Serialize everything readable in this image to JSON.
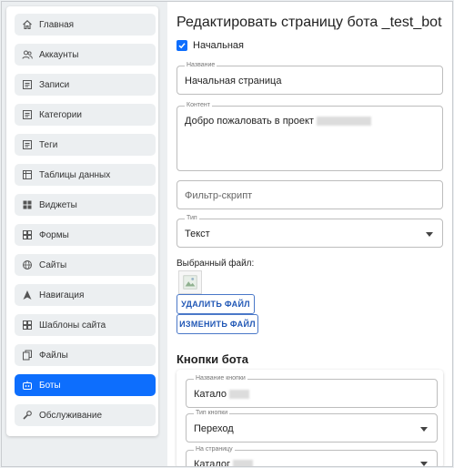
{
  "sidebar": {
    "items": [
      {
        "label": "Главная",
        "icon": "home-icon"
      },
      {
        "label": "Аккаунты",
        "icon": "users-icon"
      },
      {
        "label": "Записи",
        "icon": "document-icon"
      },
      {
        "label": "Категории",
        "icon": "document-icon"
      },
      {
        "label": "Теги",
        "icon": "document-icon"
      },
      {
        "label": "Таблицы данных",
        "icon": "table-icon"
      },
      {
        "label": "Виджеты",
        "icon": "widgets-icon"
      },
      {
        "label": "Формы",
        "icon": "forms-icon"
      },
      {
        "label": "Сайты",
        "icon": "globe-icon"
      },
      {
        "label": "Навигация",
        "icon": "navigation-icon"
      },
      {
        "label": "Шаблоны сайта",
        "icon": "templates-icon"
      },
      {
        "label": "Файлы",
        "icon": "files-icon"
      },
      {
        "label": "Боты",
        "icon": "bot-icon",
        "active": true
      },
      {
        "label": "Обслуживание",
        "icon": "wrench-icon"
      }
    ]
  },
  "main": {
    "title": "Редактировать страницу бота _test_bot",
    "checkbox_label": "Начальная",
    "fields": {
      "name_label": "Название",
      "name_value": "Начальная страница",
      "content_label": "Контент",
      "content_value": "Добро пожаловать в проект",
      "filter_placeholder": "Фильтр-скрипт",
      "type_label": "Тип",
      "type_value": "Текст"
    },
    "file": {
      "label": "Выбранный файл:",
      "delete_button": "УДАЛИТЬ ФАЙЛ",
      "change_button": "ИЗМЕНИТЬ ФАЙЛ"
    },
    "bot_buttons": {
      "title": "Кнопки бота",
      "button_name_label": "Название кнопки",
      "button_name_value": "Катало",
      "button_type_label": "Тип кнопки",
      "button_type_value": "Переход",
      "to_page_label": "На страницу",
      "to_page_value": "Каталог"
    }
  },
  "colors": {
    "accent": "#0d6efd",
    "sidebar_item_bg": "#eceff1",
    "outlined_button": "#1f56b5"
  }
}
